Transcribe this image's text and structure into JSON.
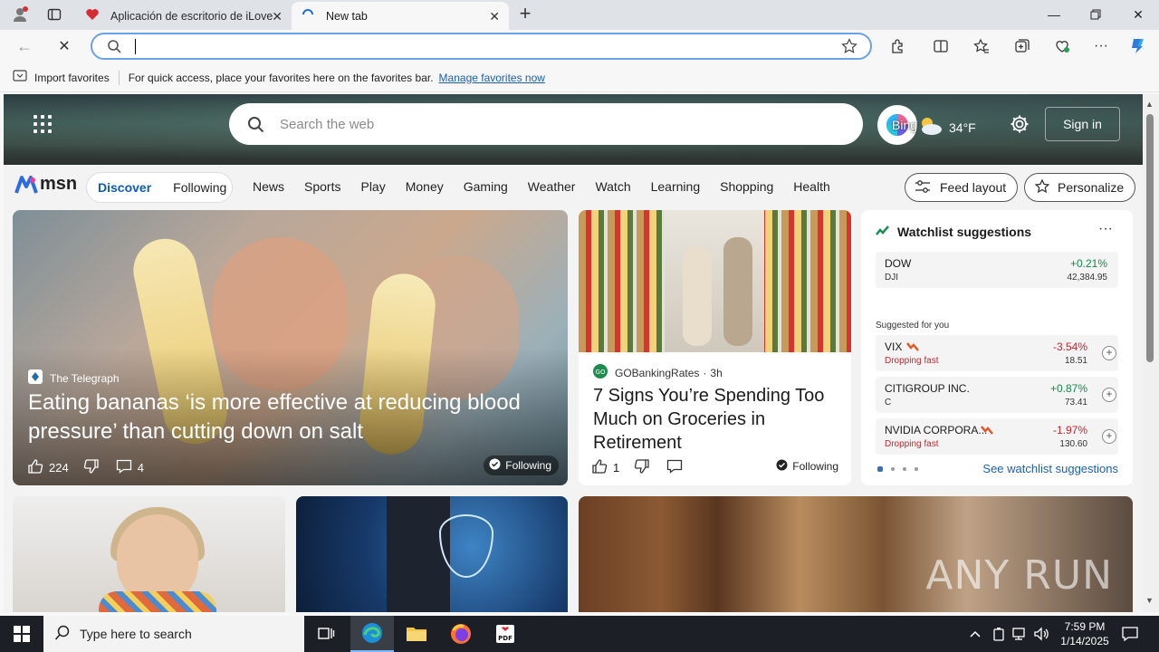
{
  "browser": {
    "tabs": [
      {
        "title": "Aplicación de escritorio de iLovePDF"
      },
      {
        "title": "New tab"
      }
    ],
    "address": {
      "value": "",
      "placeholder": ""
    },
    "favorites_bar": {
      "import_label": "Import favorites",
      "message": "For quick access, place your favorites here on the favorites bar.",
      "manage_link": "Manage favorites now"
    }
  },
  "msn": {
    "search_placeholder": "Search the web",
    "copilot_label": "Bing",
    "weather_temp": "34°F",
    "signin_label": "Sign in",
    "logo_text": "msn",
    "feed_tabs": {
      "discover": "Discover",
      "following": "Following"
    },
    "categories": [
      "News",
      "Sports",
      "Play",
      "Money",
      "Gaming",
      "Weather",
      "Watch",
      "Learning",
      "Shopping",
      "Health"
    ],
    "feed_layout_label": "Feed layout",
    "personalize_label": "Personalize",
    "hero": {
      "source": "The Telegraph",
      "title": "Eating bananas ‘is more effective at reducing blood pressure’ than cutting down on salt",
      "likes": "224",
      "comments": "4",
      "follow_label": "Following"
    },
    "groceries": {
      "source": "GOBankingRates",
      "age": "3h",
      "title": "7 Signs You’re Spending Too Much on Groceries in Retirement",
      "likes": "1",
      "follow_label": "Following"
    },
    "watchlist": {
      "title": "Watchlist suggestions",
      "suggested_label": "Suggested for you",
      "see_all": "See watchlist suggestions",
      "stocks": [
        {
          "name": "DOW",
          "sub": "DJI",
          "pct": "+0.21%",
          "price": "42,384.95",
          "direction": "up"
        },
        {
          "name": "VIX",
          "sub": "Dropping fast",
          "pct": "-3.54%",
          "price": "18.51",
          "direction": "down"
        },
        {
          "name": "CITIGROUP INC.",
          "sub": "C",
          "pct": "+0.87%",
          "price": "73.41",
          "direction": "up"
        },
        {
          "name": "NVIDIA CORPORA...",
          "sub": "Dropping fast",
          "pct": "-1.97%",
          "price": "130.60",
          "direction": "down"
        }
      ]
    },
    "watermark": "ANY RUN"
  },
  "taskbar": {
    "search_placeholder": "Type here to search",
    "time": "7:59 PM",
    "date": "1/14/2025"
  },
  "colors": {
    "accent": "#0f5bb5",
    "positive": "#128a4b",
    "negative": "#c4262e",
    "taskbar": "#1c2026"
  }
}
